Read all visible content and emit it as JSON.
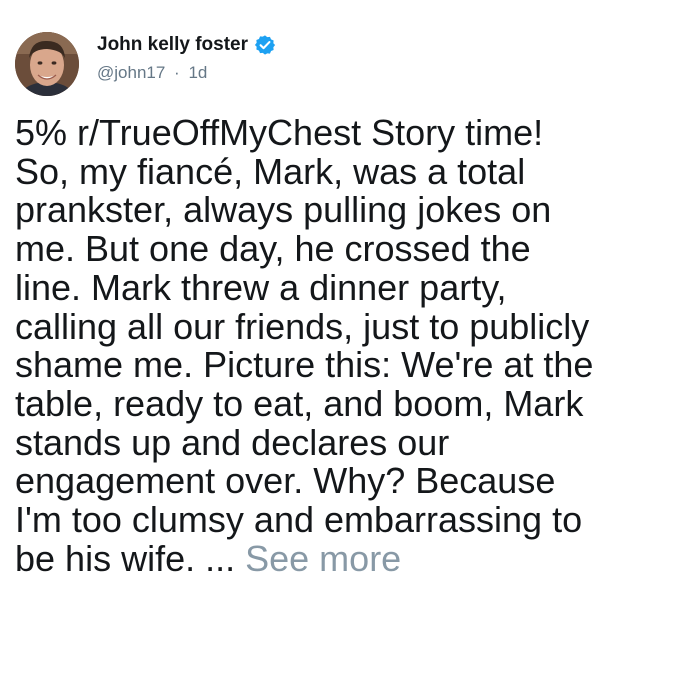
{
  "author": {
    "display_name": "John kelly foster",
    "handle": "@john17",
    "separator": "·",
    "time_ago": "1d",
    "verified": true,
    "verified_color": "#1da1f2"
  },
  "tweet": {
    "lines": [
      "5% r/TrueOffMyChest Story time!",
      "So, my fiancé, Mark, was a total",
      "prankster, always pulling jokes on",
      "me. But one day, he crossed the",
      "line. Mark threw a dinner party,",
      "calling all our friends, just to publicly",
      "shame me. Picture this: We're at the",
      "table, ready to eat, and boom, Mark",
      "stands up and declares our",
      "engagement over. Why? Because",
      "I'm too clumsy and embarrassing to"
    ],
    "last_line": "be his wife. ...",
    "see_more_label": "See more",
    "see_more_color": "#8899a6"
  },
  "icons": {
    "verified": "verified-badge-icon"
  }
}
